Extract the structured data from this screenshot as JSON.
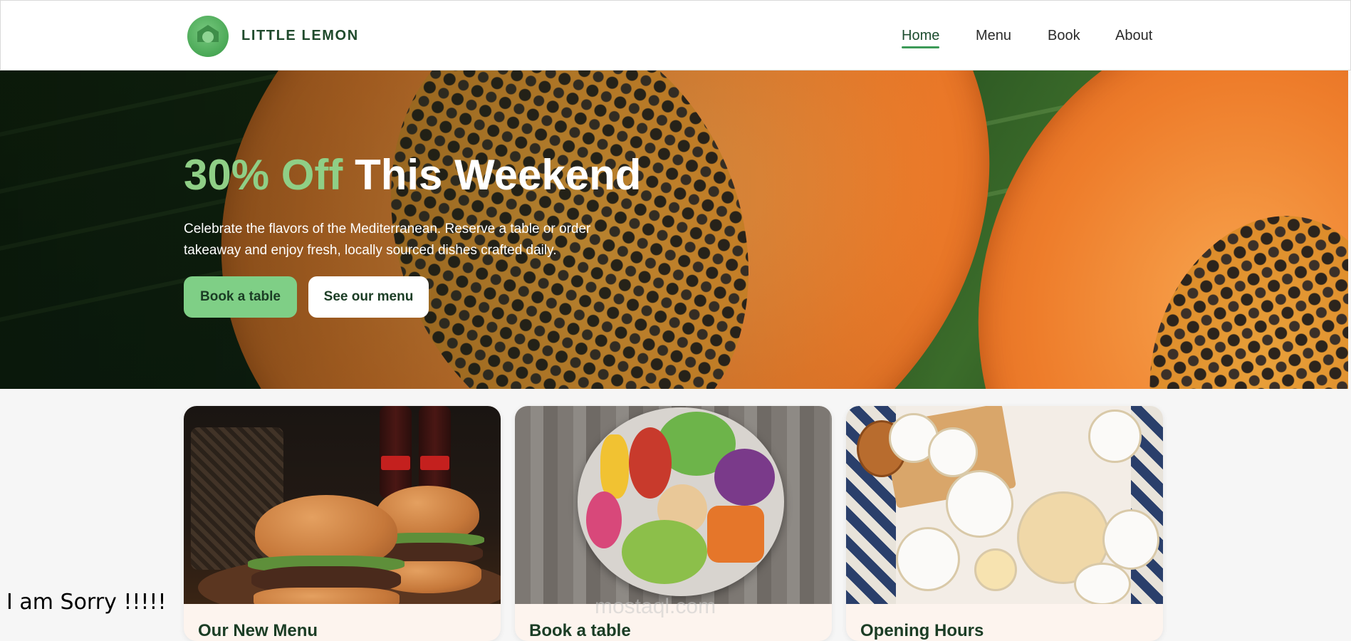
{
  "brand": {
    "name": "LITTLE LEMON",
    "logo_icon": "lemon-house-logo"
  },
  "nav": {
    "items": [
      {
        "label": "Home",
        "active": true
      },
      {
        "label": "Menu",
        "active": false
      },
      {
        "label": "Book",
        "active": false
      },
      {
        "label": "About",
        "active": false
      }
    ]
  },
  "hero": {
    "title_accent": "30% Off",
    "title_rest": "This Weekend",
    "subtitle": "Celebrate the flavors of the Mediterranean. Reserve a table or order takeaway and enjoy fresh, locally sourced dishes crafted daily.",
    "primary_button": "Book a table",
    "secondary_button": "See our menu"
  },
  "cards": [
    {
      "title": "Our New Menu"
    },
    {
      "title": "Book a table"
    },
    {
      "title": "Opening Hours"
    }
  ],
  "watermark": {
    "text": "mostaql.com"
  },
  "overlay_text": "I am Sorry !!!!!",
  "colors": {
    "accent_green": "#7fcf86",
    "title_accent": "#8fcf86",
    "dark_green": "#1b3d25",
    "card_bg": "#fdf4ee"
  }
}
